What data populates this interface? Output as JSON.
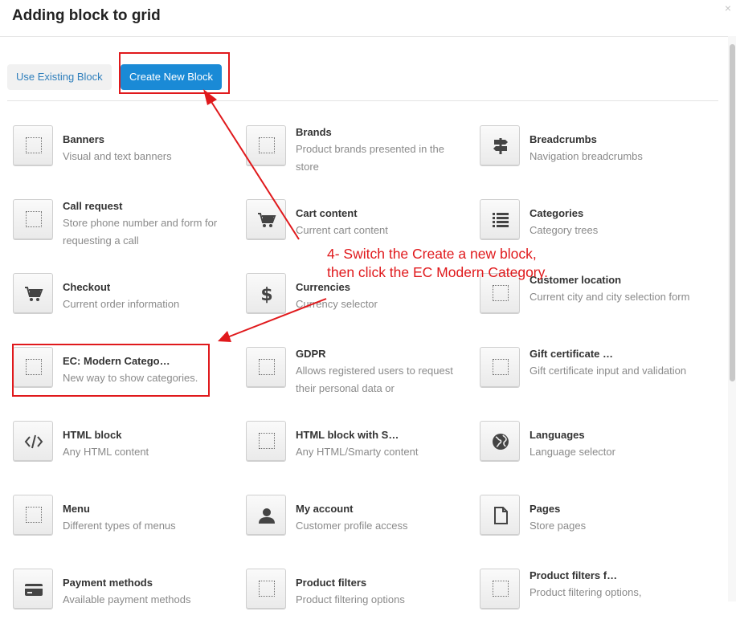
{
  "dialog": {
    "title": "Adding block to grid",
    "close_label": "×"
  },
  "tabs": {
    "existing": "Use Existing Block",
    "create": "Create New Block"
  },
  "blocks": [
    {
      "name": "Banners",
      "desc": "Visual and text banners",
      "icon": "dotted-square-icon"
    },
    {
      "name": "Brands",
      "desc": "Product brands presented in the store",
      "icon": "dotted-square-icon"
    },
    {
      "name": "Breadcrumbs",
      "desc": "Navigation breadcrumbs",
      "icon": "signpost-icon"
    },
    {
      "name": "Call request",
      "desc": "Store phone number and form for requesting a call",
      "icon": "dotted-square-icon"
    },
    {
      "name": "Cart content",
      "desc": "Current cart content",
      "icon": "cart-icon"
    },
    {
      "name": "Categories",
      "desc": "Category trees",
      "icon": "list-icon"
    },
    {
      "name": "Checkout",
      "desc": "Current order information",
      "icon": "cart-icon"
    },
    {
      "name": "Currencies",
      "desc": "Currency selector",
      "icon": "dollar-icon"
    },
    {
      "name": "Customer location",
      "desc": "Current city and city selection form",
      "icon": "dotted-square-icon"
    },
    {
      "name": "EC: Modern Catego…",
      "desc": "New way to show categories.",
      "icon": "dotted-square-icon"
    },
    {
      "name": "GDPR",
      "desc": "Allows registered users to request their personal data or",
      "icon": "dotted-square-icon"
    },
    {
      "name": "Gift certificate …",
      "desc": "Gift certificate input and validation",
      "icon": "dotted-square-icon"
    },
    {
      "name": "HTML block",
      "desc": "Any HTML content",
      "icon": "code-icon"
    },
    {
      "name": "HTML block with S…",
      "desc": "Any HTML/Smarty content",
      "icon": "dotted-square-icon"
    },
    {
      "name": "Languages",
      "desc": "Language selector",
      "icon": "globe-icon"
    },
    {
      "name": "Menu",
      "desc": "Different types of menus",
      "icon": "dotted-square-icon"
    },
    {
      "name": "My account",
      "desc": "Customer profile access",
      "icon": "user-icon"
    },
    {
      "name": "Pages",
      "desc": "Store pages",
      "icon": "page-icon"
    },
    {
      "name": "Payment methods",
      "desc": "Available payment methods",
      "icon": "credit-card-icon"
    },
    {
      "name": "Product filters",
      "desc": "Product filtering options",
      "icon": "dotted-square-icon"
    },
    {
      "name": "Product filters f…",
      "desc": "Product filtering options,",
      "icon": "dotted-square-icon"
    }
  ],
  "annotation": {
    "line1": "4- Switch the Create a new block,",
    "line2": "then click the EC Modern Category."
  },
  "colors": {
    "accent": "#1a8ad6",
    "annotation": "#e0191c"
  }
}
